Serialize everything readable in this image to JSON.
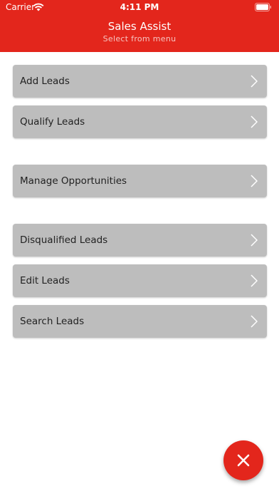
{
  "status_bar": {
    "carrier": "Carrier",
    "time": "4:11 PM"
  },
  "header": {
    "title": "Sales Assist",
    "subtitle": "Select from menu",
    "color": "#e3261c"
  },
  "menu": {
    "items": [
      {
        "label": "Add Leads"
      },
      {
        "label": "Qualify Leads"
      },
      {
        "label": "Manage Opportunities"
      },
      {
        "label": "Disqualified Leads"
      },
      {
        "label": "Edit Leads"
      },
      {
        "label": "Search Leads"
      }
    ]
  },
  "fab": {
    "icon": "close-icon"
  }
}
